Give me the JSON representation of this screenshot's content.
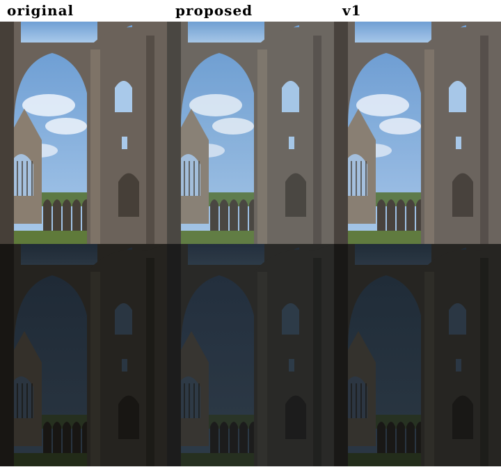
{
  "columns": [
    {
      "label": "original"
    },
    {
      "label": "proposed"
    },
    {
      "label": "v1"
    }
  ],
  "rows": [
    {
      "tone": "bright"
    },
    {
      "tone": "dark"
    }
  ],
  "colors": {
    "sky_bright": "#a9c9ea",
    "sky_dark": "#2a3642",
    "stone_bright": "#6b625a",
    "stone_dark": "#25231f",
    "grass_bright": "#5f7a3a",
    "grass_dark": "#222b18"
  }
}
